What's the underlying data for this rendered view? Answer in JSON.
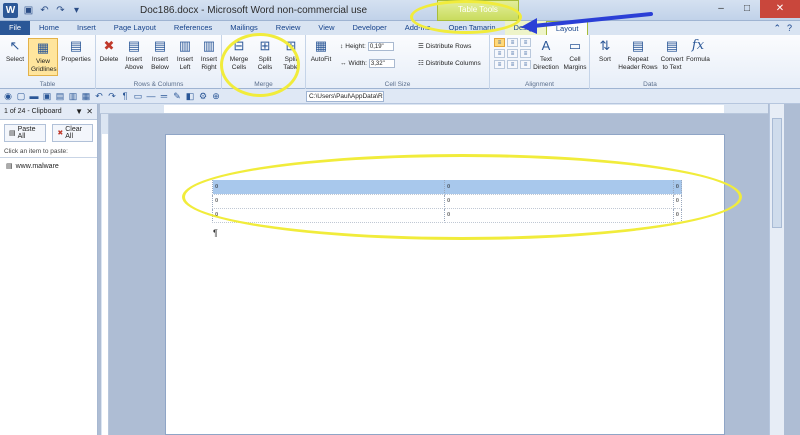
{
  "window": {
    "title": "Doc186.docx - Microsoft Word non-commercial use",
    "contextual_tab_group": "Table Tools",
    "app_icon": "W"
  },
  "tabs": [
    {
      "label": "File"
    },
    {
      "label": "Home"
    },
    {
      "label": "Insert"
    },
    {
      "label": "Page Layout"
    },
    {
      "label": "References"
    },
    {
      "label": "Mailings"
    },
    {
      "label": "Review"
    },
    {
      "label": "View"
    },
    {
      "label": "Developer"
    },
    {
      "label": "Add-Ins"
    },
    {
      "label": "Open Tamarin"
    },
    {
      "label": "Design"
    },
    {
      "label": "Layout"
    }
  ],
  "ribbon": {
    "table_group": {
      "label": "Table",
      "select": "Select",
      "view_gridlines": "View Gridlines",
      "properties": "Properties"
    },
    "rows_columns_group": {
      "label": "Rows & Columns",
      "delete": "Delete",
      "insert_above": "Insert Above",
      "insert_below": "Insert Below",
      "insert_left": "Insert Left",
      "insert_right": "Insert Right"
    },
    "merge_group": {
      "label": "Merge",
      "merge_cells": "Merge Cells",
      "split_cells": "Split Cells",
      "split_table": "Split Table"
    },
    "cell_size_group": {
      "label": "Cell Size",
      "autofit": "AutoFit",
      "height_label": "Height:",
      "height_value": "0,19\"",
      "width_label": "Width:",
      "width_value": "3,32\"",
      "distribute_rows": "Distribute Rows",
      "distribute_columns": "Distribute Columns"
    },
    "alignment_group": {
      "label": "Alignment",
      "text_direction": "Text Direction",
      "cell_margins": "Cell Margins"
    },
    "data_group": {
      "label": "Data",
      "sort": "Sort",
      "repeat_header_rows": "Repeat Header Rows",
      "convert_to_text": "Convert to Text",
      "formula": "Formula"
    }
  },
  "toolbar": {
    "path": "C:\\Users\\Paul\\AppData\\Roamir"
  },
  "clipboard_pane": {
    "title": "1 of 24 - Clipboard",
    "paste_all": "Paste All",
    "clear_all": "Clear All",
    "hint": "Click an item to paste:",
    "items": [
      {
        "label": "www.malware"
      }
    ]
  },
  "document": {
    "table_rows": [
      {
        "cells": [
          "¤",
          "¤"
        ],
        "end": "¤",
        "selected": true
      },
      {
        "cells": [
          "¤",
          "¤"
        ],
        "end": "¤",
        "selected": false
      },
      {
        "cells": [
          "¤",
          "¤"
        ],
        "end": "¤",
        "selected": false
      }
    ],
    "pilcrow": "¶"
  },
  "annotation": {
    "highlight_color": "#f1ec3b",
    "arrow_color": "#2b3fd6"
  }
}
